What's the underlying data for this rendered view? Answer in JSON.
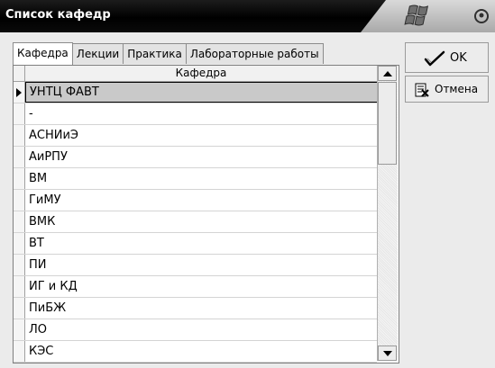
{
  "window": {
    "title": "Список кафедр"
  },
  "tabs": [
    {
      "label": "Кафедра",
      "active": true
    },
    {
      "label": "Лекции",
      "active": false
    },
    {
      "label": "Практика",
      "active": false
    },
    {
      "label": "Лабораторные работы",
      "active": false
    }
  ],
  "grid": {
    "column_header": "Кафедра",
    "selected_index": 0,
    "rows": [
      "УНТЦ ФАВТ",
      "-",
      "АСНИиЭ",
      "АиРПУ",
      "ВМ",
      "ГиМУ",
      "ВМК",
      "ВТ",
      "ПИ",
      "ИГ и КД",
      "ПиБЖ",
      "ЛО",
      "КЭС"
    ]
  },
  "buttons": {
    "ok_label": "OK",
    "ok_icon": "checkmark-icon",
    "cancel_label": "Отмена",
    "cancel_icon": "cancel-doc-icon"
  }
}
